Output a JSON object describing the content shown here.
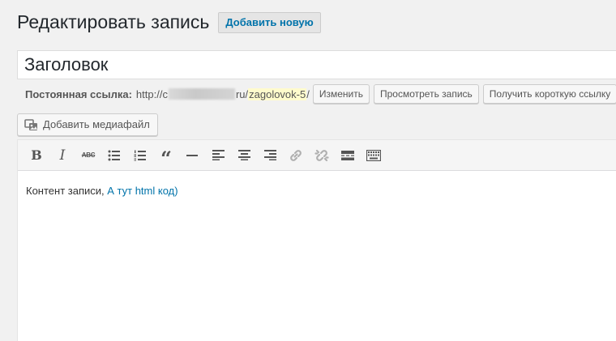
{
  "header": {
    "title": "Редактировать запись",
    "add_new_label": "Добавить новую"
  },
  "post": {
    "title_value": "Заголовок"
  },
  "permalink": {
    "label": "Постоянная ссылка:",
    "url_prefix": "http://c",
    "url_domain_end": "ru/",
    "slug": "zagolovok-5",
    "url_suffix": "/",
    "edit_label": "Изменить",
    "view_label": "Просмотреть запись",
    "shortlink_label": "Получить короткую ссылку"
  },
  "media": {
    "add_media_label": "Добавить медиафайл",
    "icon": "media-icon"
  },
  "toolbar": {
    "bold": "B",
    "italic": "I",
    "strike": "ABC",
    "quote": "“",
    "icons": [
      "bold-icon",
      "italic-icon",
      "strikethrough-icon",
      "bullet-list-icon",
      "numbered-list-icon",
      "blockquote-icon",
      "horizontal-line-icon",
      "align-left-icon",
      "align-center-icon",
      "align-right-icon",
      "link-icon",
      "unlink-icon",
      "read-more-icon",
      "toolbar-toggle-icon"
    ]
  },
  "content": {
    "text": "Контент записи, ",
    "link_text": "А тут html код)"
  },
  "colors": {
    "link": "#0073aa",
    "slug_highlight": "#fffbcc",
    "background": "#f1f1f1"
  }
}
